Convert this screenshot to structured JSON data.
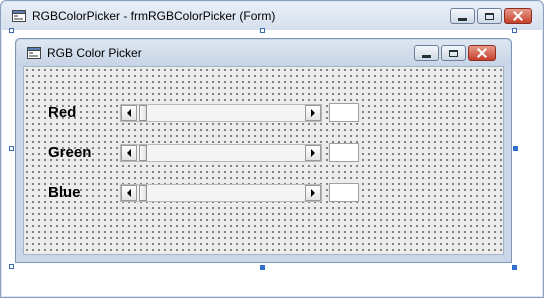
{
  "outer_window": {
    "title": "RGBColorPicker - frmRGBColorPicker (Form)"
  },
  "form": {
    "title": "RGB Color Picker",
    "controls": [
      {
        "label": "Red",
        "value": ""
      },
      {
        "label": "Green",
        "value": ""
      },
      {
        "label": "Blue",
        "value": ""
      }
    ]
  },
  "icons": {
    "window_icon": "form-icon",
    "minimize": "minimize-icon",
    "maximize": "maximize-icon",
    "close": "close-icon",
    "scroll_left": "arrow-left-icon",
    "scroll_right": "arrow-right-icon"
  },
  "colors": {
    "close_button": "#c4402a",
    "selection_handle": "#2e6fd0",
    "form_background": "#ececec"
  }
}
